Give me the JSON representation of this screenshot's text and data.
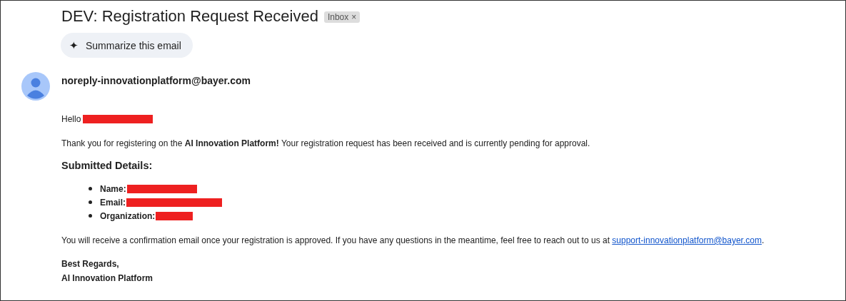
{
  "subject": "DEV: Registration Request Received",
  "label": {
    "text": "Inbox",
    "close": "×"
  },
  "summarize_button": {
    "icon": "✦",
    "label": "Summarize this email"
  },
  "sender": "noreply-innovationplatform@bayer.com",
  "body": {
    "greeting": {
      "text": "Hello",
      "redacted": true
    },
    "intro": "Thank you for registering on the **AI Innovation Platform!** Your registration request has been received and is currently pending for approval.",
    "details_heading": "Submitted Details:",
    "details": [
      {
        "label": "Name:",
        "redacted": true
      },
      {
        "label": "Email:",
        "redacted": true
      },
      {
        "label": "Organization:",
        "redacted": true
      }
    ],
    "closing": "You will receive a confirmation email once your registration is approved. If you have any questions in the meantime, feel free to reach out to us at",
    "support_link": "support-innovationplatform@bayer.com",
    "closing_end": ".",
    "signoff": [
      "Best Regards,",
      "AI Innovation Platform"
    ]
  }
}
